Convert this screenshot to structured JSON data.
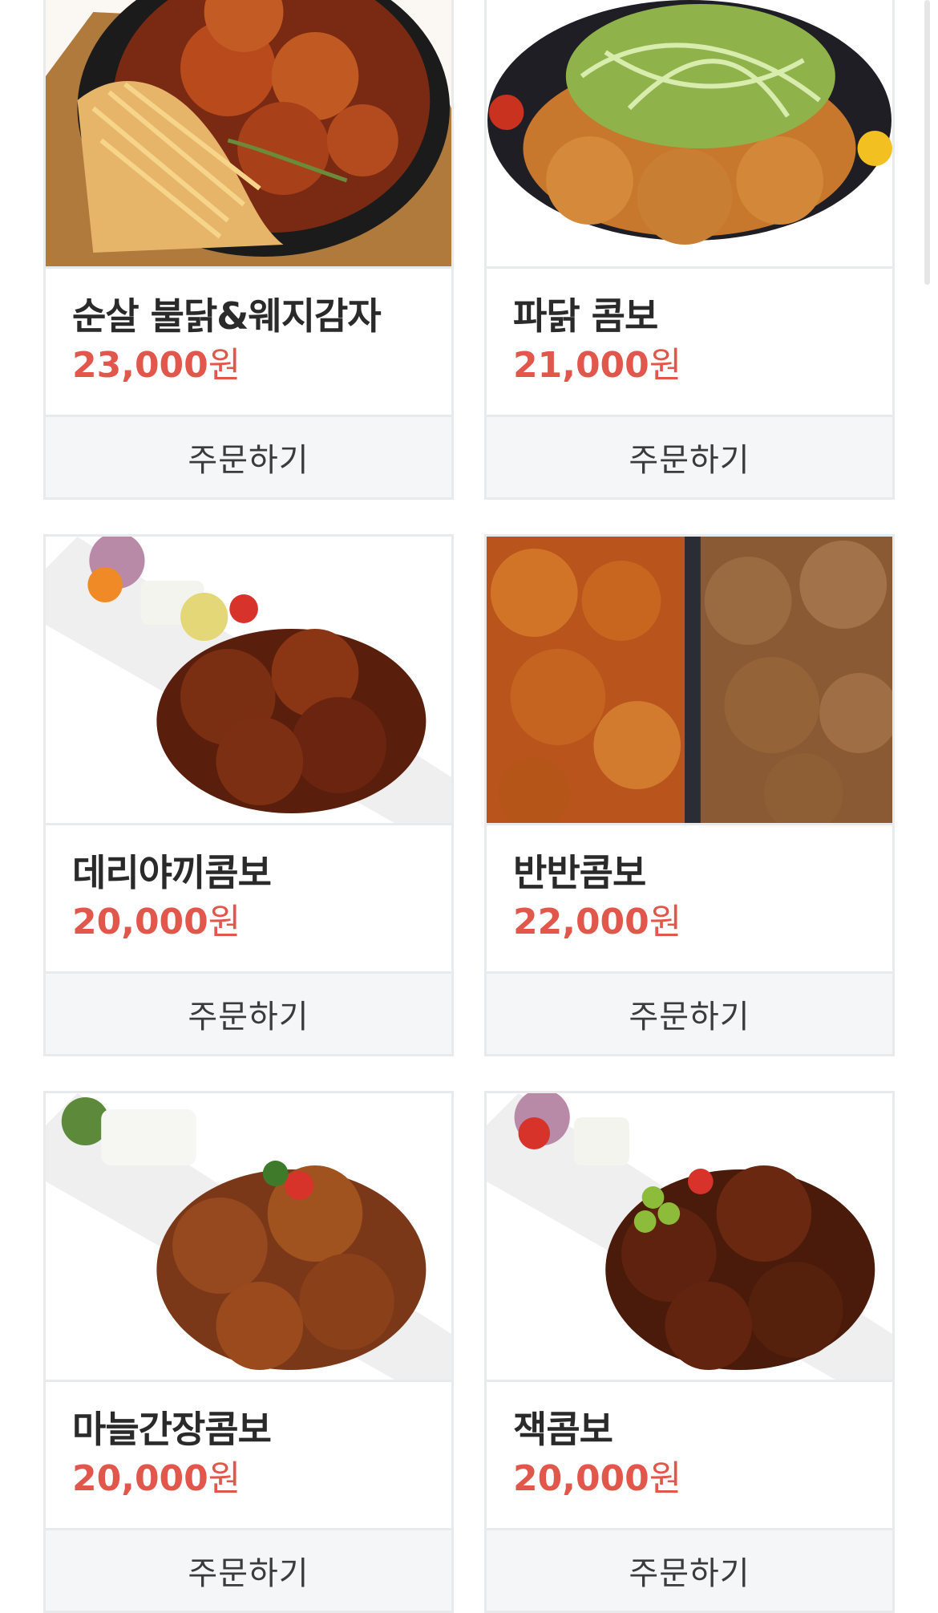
{
  "order_label": "주문하기",
  "currency_unit": "원",
  "menu_items": [
    {
      "name": "순살 불닭&웨지감자",
      "price": "23,000",
      "photo": "chicken-wedge-potato-photo"
    },
    {
      "name": "파닭 콤보",
      "price": "21,000",
      "photo": "green-onion-chicken-photo"
    },
    {
      "name": "데리야끼콤보",
      "price": "20,000",
      "photo": "teriyaki-chicken-photo"
    },
    {
      "name": "반반콤보",
      "price": "22,000",
      "photo": "half-half-chicken-photo"
    },
    {
      "name": "마늘간장콤보",
      "price": "20,000",
      "photo": "garlic-soy-chicken-photo"
    },
    {
      "name": "잭콤보",
      "price": "20,000",
      "photo": "jack-chicken-photo"
    }
  ],
  "colors": {
    "price": "#e2574c",
    "border": "#e9eaec",
    "button_bg": "#f5f6f8"
  }
}
